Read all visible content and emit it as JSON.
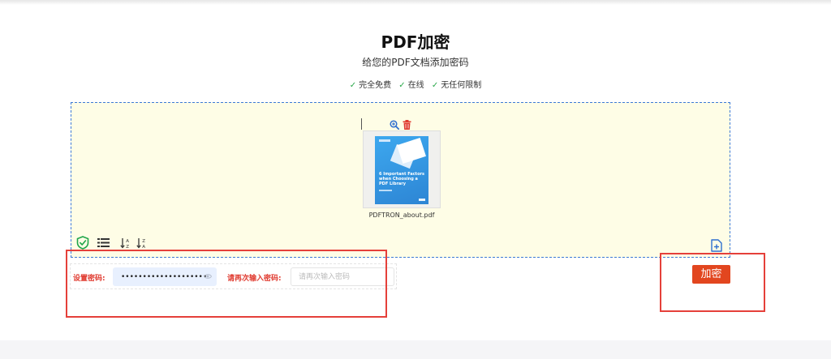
{
  "header": {
    "title": "PDF加密",
    "subtitle": "给您的PDF文档添加密码",
    "features": [
      {
        "check": "✓",
        "label": "完全免费"
      },
      {
        "check": "✓",
        "label": "在线"
      },
      {
        "check": "✓",
        "label": "无任何限制"
      }
    ]
  },
  "dropzone": {
    "file": {
      "name": "PDFTRON_about.pdf",
      "thumbnail_title": "6 Important Factors when Choosing a PDF Library"
    },
    "file_actions": {
      "zoom_icon": "zoom-in-icon",
      "delete_icon": "trash-icon"
    },
    "toolbar": {
      "icons": [
        "shield-check-icon",
        "list-icon",
        "sort-az-icon",
        "sort-za-icon"
      ],
      "sort_az": "A-Z",
      "sort_za": "Z-A"
    },
    "add_file_icon": "add-file-icon"
  },
  "password": {
    "label": "设置密码:",
    "value": "••••••••••••••••••••",
    "confirm_label": "请再次输入密码:",
    "confirm_placeholder": "请再次输入密码"
  },
  "actions": {
    "encrypt_label": "加密"
  },
  "colors": {
    "accent": "#e2461f",
    "label_red": "#e03a2f",
    "dropzone_bg": "#fefde6",
    "dropzone_border": "#3d7ad6",
    "check_green": "#2aa84a",
    "highlight": "#e5403a"
  }
}
